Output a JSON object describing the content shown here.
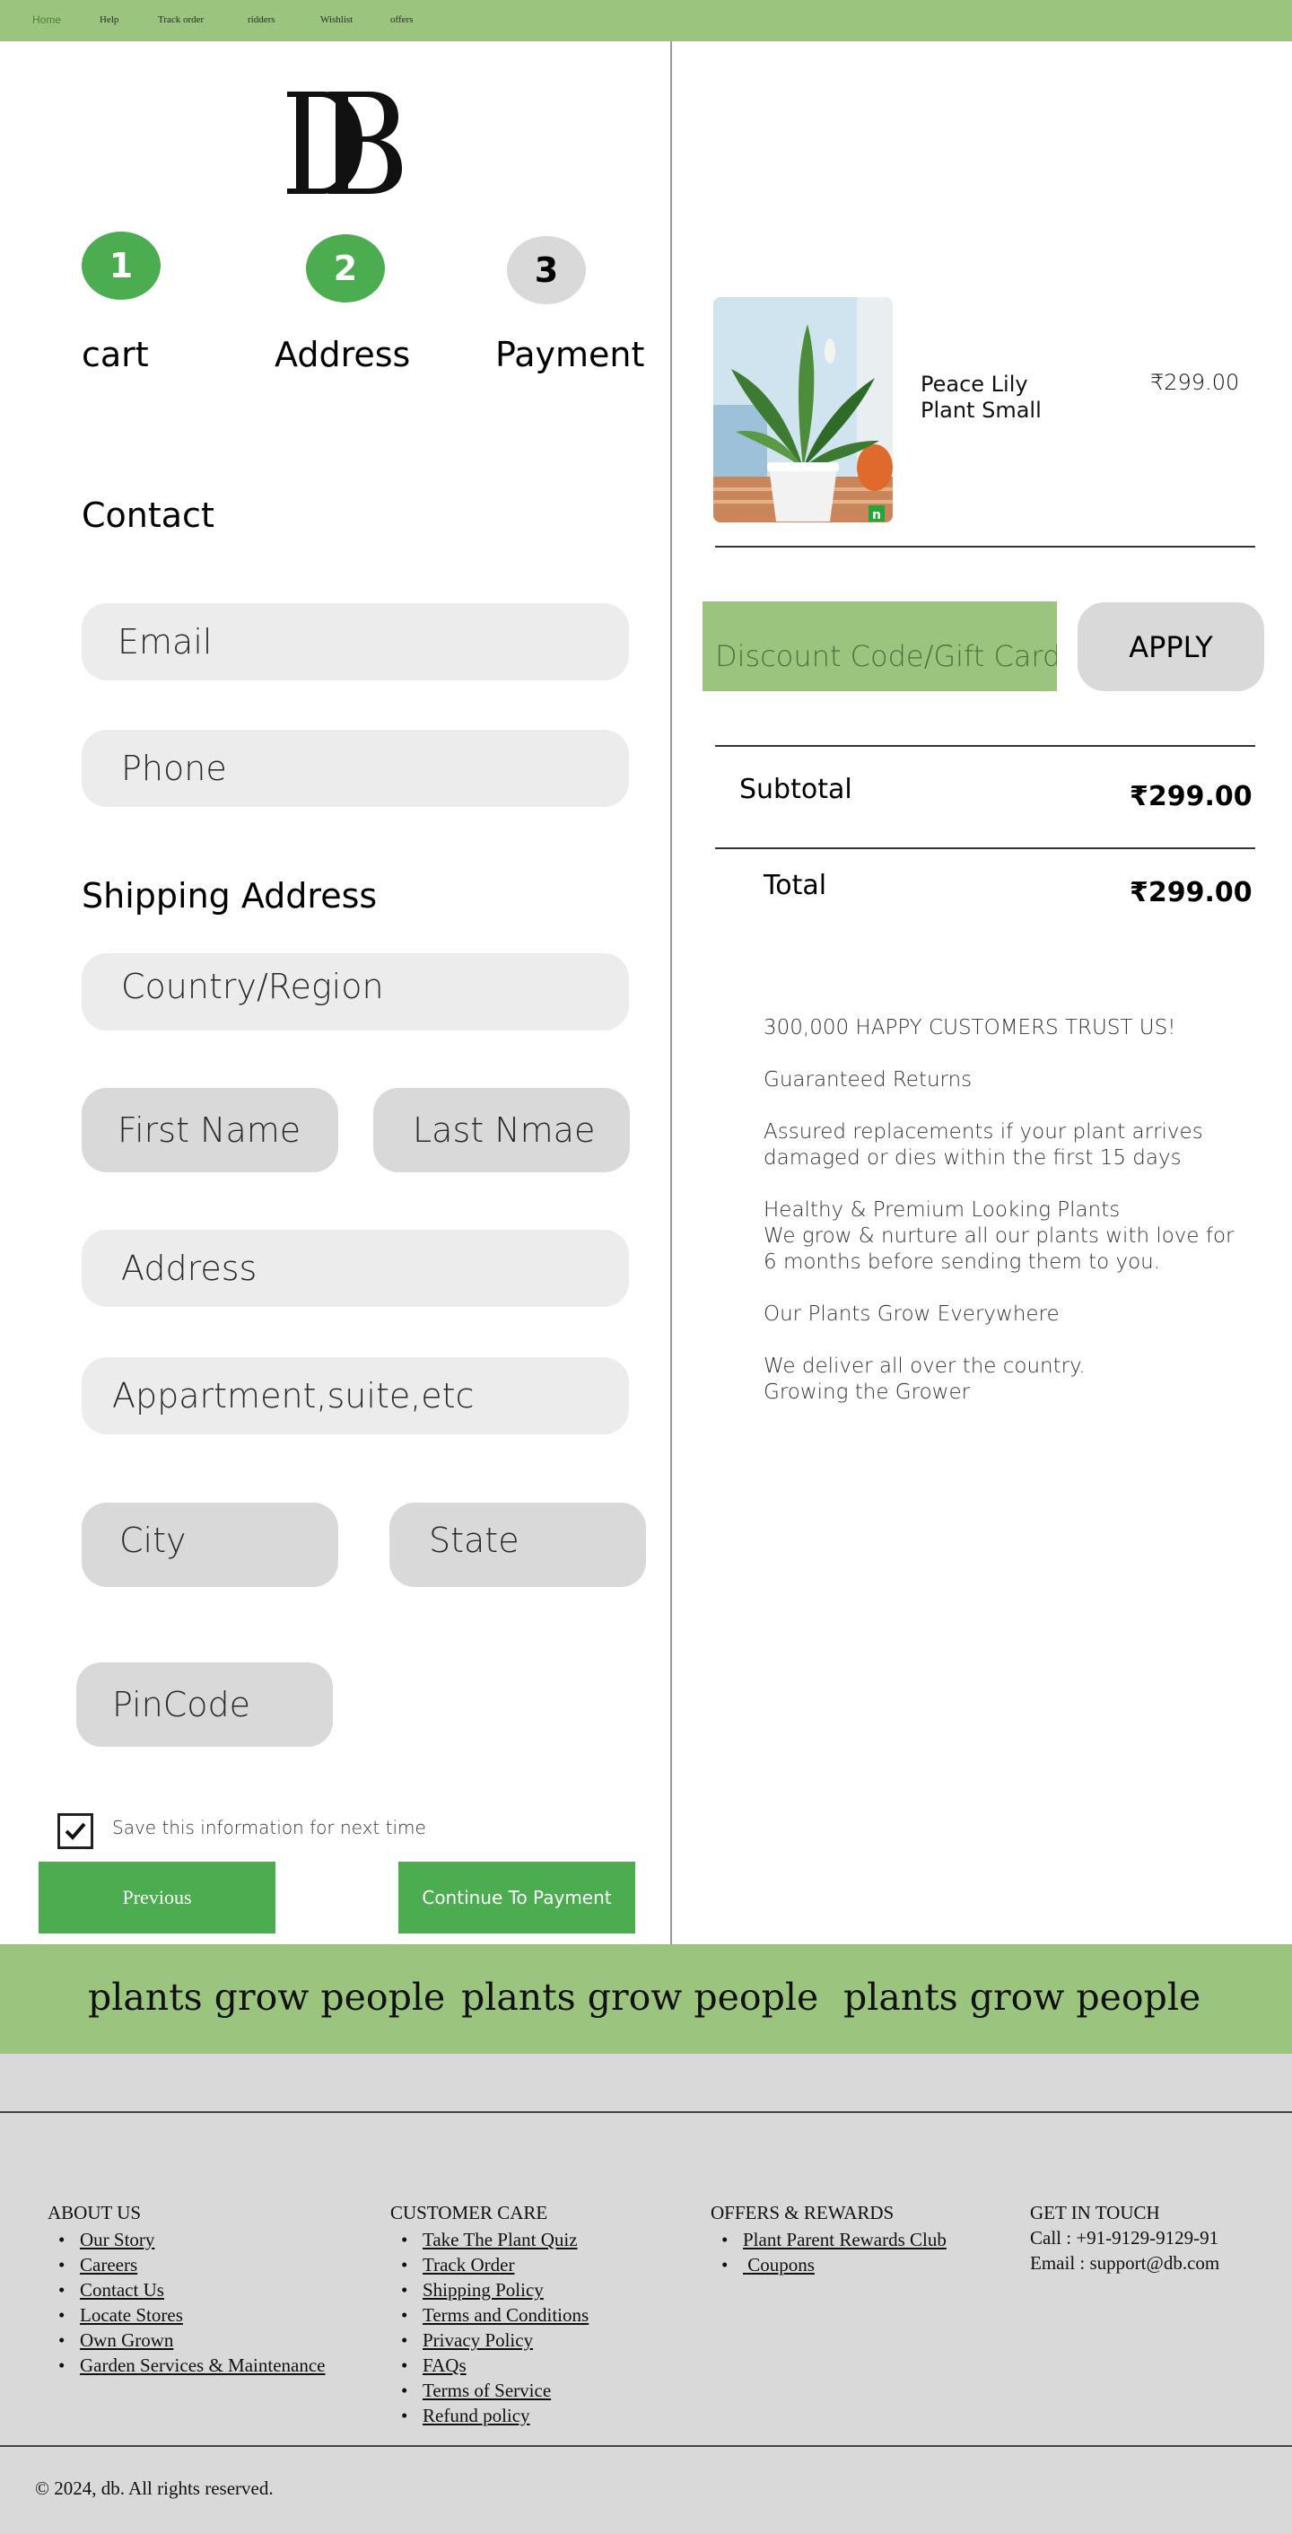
{
  "nav": {
    "items": [
      "Home",
      "Help",
      "Track order",
      "ridders",
      "Wishlist",
      "offers"
    ]
  },
  "colors": {
    "brand_green": "#4cad50",
    "light_green": "#9bc57f",
    "field_gray": "#ececec",
    "footer_gray": "#d9d9d9"
  },
  "steps": [
    {
      "number": "1",
      "label": "cart",
      "status": "done"
    },
    {
      "number": "2",
      "label": "Address",
      "status": "done"
    },
    {
      "number": "3",
      "label": "Payment",
      "status": "pending"
    }
  ],
  "contact": {
    "title": "Contact",
    "email_placeholder": "Email",
    "phone_placeholder": "Phone"
  },
  "shipping": {
    "title": "Shipping Address",
    "country_placeholder": "Country/Region",
    "first_name_placeholder": "First Name",
    "last_name_placeholder": "Last Nmae",
    "address_placeholder": "Address",
    "apartment_placeholder": "Appartment,suite,etc",
    "city_placeholder": "City",
    "state_placeholder": "State",
    "pincode_placeholder": "PinCode"
  },
  "save_info": {
    "label": "Save this information for next time",
    "checked": true
  },
  "buttons": {
    "previous": "Previous",
    "continue": "Continue To Payment",
    "apply": "APPLY"
  },
  "cart": {
    "product_name": "Peace Lily Plant Small",
    "product_price": "₹299.00",
    "discount_placeholder": "Discount Code/Gift Card",
    "subtotal_label": "Subtotal",
    "subtotal_value": "₹299.00",
    "total_label": "Total",
    "total_value": "₹299.00"
  },
  "trust": {
    "lines": [
      "300,000 HAPPY CUSTOMERS TRUST US!",
      "Guaranteed Returns",
      "Assured replacements if your plant arrives",
      "damaged or dies within the first 15 days",
      "Healthy & Premium Looking Plants",
      "We grow & nurture all our plants with love for",
      "6 months before sending them to you.",
      "Our Plants Grow Everywhere",
      "We deliver all over the country.",
      "Growing the Grower"
    ]
  },
  "banner": {
    "text": "plants grow people"
  },
  "footer": {
    "about": {
      "title": "ABOUT US",
      "links": [
        "Our Story",
        "Careers",
        "Contact Us",
        "Locate Stores",
        "Own Grown",
        "Garden Services & Maintenance"
      ]
    },
    "care": {
      "title": "CUSTOMER CARE",
      "links": [
        "Take The Plant Quiz",
        "Track Order",
        "Shipping Policy",
        "Terms and Conditions",
        "Privacy Policy",
        "FAQs",
        "Terms of Service",
        "Refund policy"
      ]
    },
    "offers": {
      "title": "OFFERS & REWARDS",
      "links": [
        "Plant Parent Rewards Club",
        " Coupons"
      ]
    },
    "contact": {
      "title": "GET IN TOUCH",
      "call": "Call : +91-9129-9129-91",
      "email": "Email : support@db.com"
    },
    "copyright": "© 2024, db. All rights reserved."
  }
}
